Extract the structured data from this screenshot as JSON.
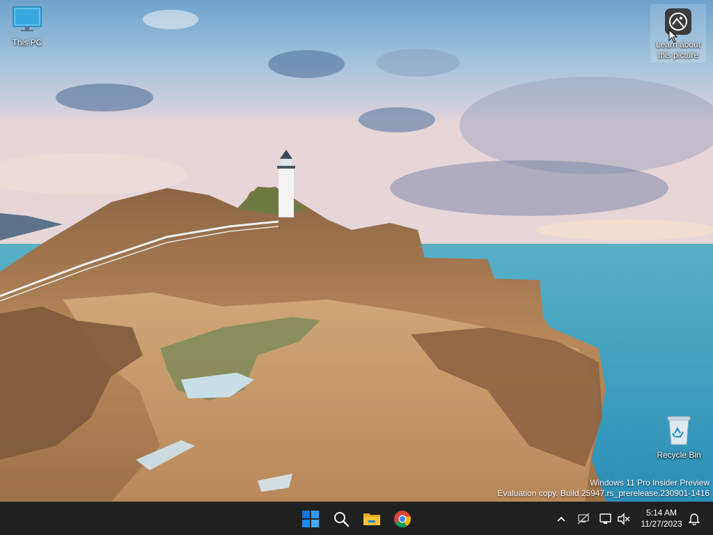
{
  "desktop": {
    "icons": {
      "this_pc": {
        "label": "This PC",
        "icon": "computer-monitor-icon"
      },
      "recycle_bin": {
        "label": "Recycle Bin",
        "icon": "recycle-bin-icon"
      },
      "learn": {
        "label_line1": "Learn about",
        "label_line2": "this picture",
        "icon": "camera-icon"
      }
    },
    "watermark": {
      "line1": "Windows 11 Pro Insider Preview",
      "line2": "Evaluation copy. Build 25947.rs_prerelease.230901-1416"
    }
  },
  "taskbar": {
    "apps": [
      {
        "name": "Start",
        "icon": "windows-logo-icon"
      },
      {
        "name": "Search",
        "icon": "search-icon"
      },
      {
        "name": "File Explorer",
        "icon": "folder-icon"
      },
      {
        "name": "Google Chrome",
        "icon": "chrome-icon"
      }
    ],
    "tray": {
      "time": "5:14 AM",
      "date": "11/27/2023",
      "icons": [
        "chevron-up-icon",
        "network-disconnected-icon",
        "display-icon",
        "volume-muted-icon",
        "bell-icon"
      ]
    }
  },
  "colors": {
    "taskbar_bg": "#202020",
    "windows_blue": "#0a74d6",
    "folder_yellow": "#f5c43d"
  }
}
